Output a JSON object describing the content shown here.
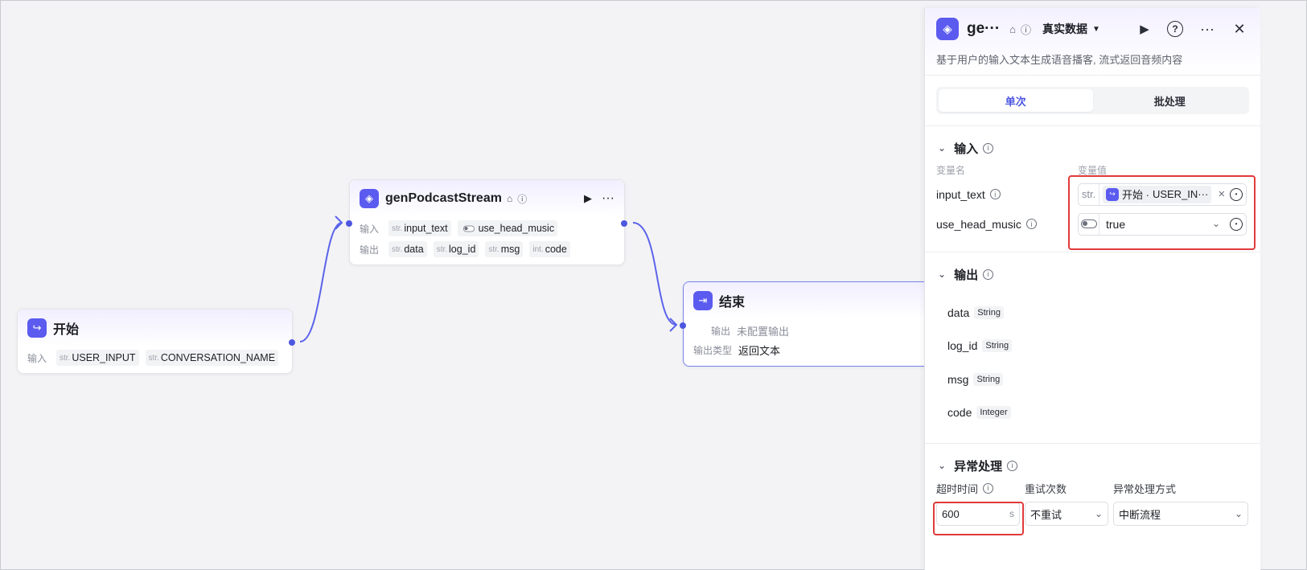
{
  "nodes": {
    "start": {
      "title": "开始",
      "input_label": "输入",
      "inputs": [
        {
          "type": "str.",
          "name": "USER_INPUT"
        },
        {
          "type": "str.",
          "name": "CONVERSATION_NAME"
        }
      ]
    },
    "plugin": {
      "title": "genPodcastStream",
      "input_label": "输入",
      "output_label": "输出",
      "inputs": [
        {
          "type": "str.",
          "name": "input_text"
        },
        {
          "type": "toggle",
          "name": "use_head_music"
        }
      ],
      "outputs": [
        {
          "type": "str.",
          "name": "data"
        },
        {
          "type": "str.",
          "name": "log_id"
        },
        {
          "type": "str.",
          "name": "msg"
        },
        {
          "type": "int.",
          "name": "code"
        }
      ]
    },
    "end": {
      "title": "结束",
      "output_label": "输出",
      "output_value": "未配置输出",
      "output_type_label": "输出类型",
      "output_type_value": "返回文本"
    }
  },
  "panel": {
    "title": "ge···",
    "data_mode": "真实数据",
    "description": "基于用户的输入文本生成语音播客, 流式返回音频内容",
    "tabs": [
      {
        "label": "单次",
        "active": true
      },
      {
        "label": "批处理",
        "active": false
      }
    ],
    "input_section": {
      "title": "输入",
      "col_name": "变量名",
      "col_value": "变量值",
      "rows": [
        {
          "name": "input_text",
          "prefix": "str.",
          "ref_node": "开始 ·",
          "ref_var": "USER_IN···"
        },
        {
          "name": "use_head_music",
          "value": "true"
        }
      ]
    },
    "output_section": {
      "title": "输出",
      "items": [
        {
          "name": "data",
          "type": "String"
        },
        {
          "name": "log_id",
          "type": "String"
        },
        {
          "name": "msg",
          "type": "String"
        },
        {
          "name": "code",
          "type": "Integer"
        }
      ]
    },
    "error_section": {
      "title": "异常处理",
      "timeout_label": "超时时间",
      "timeout_value": "600",
      "timeout_unit": "s",
      "retry_label": "重试次数",
      "retry_value": "不重试",
      "handling_label": "异常处理方式",
      "handling_value": "中断流程"
    }
  },
  "colors": {
    "accent": "#4e57e0",
    "highlight": "#e23a3a"
  }
}
